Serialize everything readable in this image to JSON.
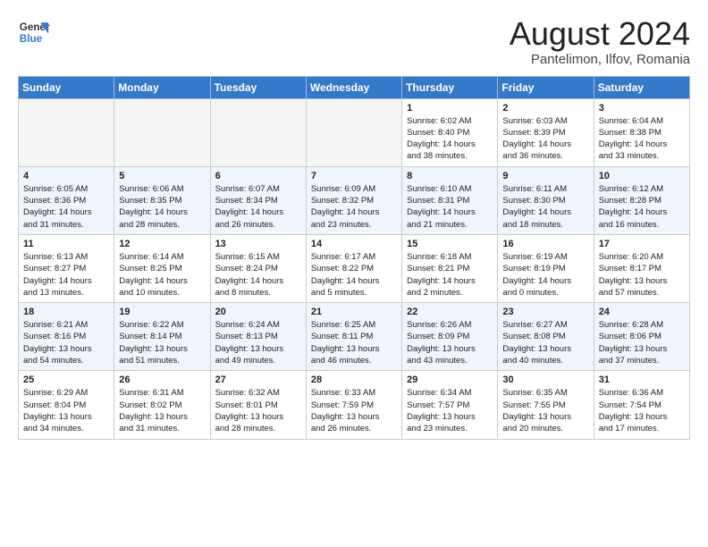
{
  "header": {
    "logo_general": "General",
    "logo_blue": "Blue",
    "month_year": "August 2024",
    "location": "Pantelimon, Ilfov, Romania"
  },
  "weekdays": [
    "Sunday",
    "Monday",
    "Tuesday",
    "Wednesday",
    "Thursday",
    "Friday",
    "Saturday"
  ],
  "weeks": [
    [
      {
        "day": "",
        "info": ""
      },
      {
        "day": "",
        "info": ""
      },
      {
        "day": "",
        "info": ""
      },
      {
        "day": "",
        "info": ""
      },
      {
        "day": "1",
        "info": "Sunrise: 6:02 AM\nSunset: 8:40 PM\nDaylight: 14 hours\nand 38 minutes."
      },
      {
        "day": "2",
        "info": "Sunrise: 6:03 AM\nSunset: 8:39 PM\nDaylight: 14 hours\nand 36 minutes."
      },
      {
        "day": "3",
        "info": "Sunrise: 6:04 AM\nSunset: 8:38 PM\nDaylight: 14 hours\nand 33 minutes."
      }
    ],
    [
      {
        "day": "4",
        "info": "Sunrise: 6:05 AM\nSunset: 8:36 PM\nDaylight: 14 hours\nand 31 minutes."
      },
      {
        "day": "5",
        "info": "Sunrise: 6:06 AM\nSunset: 8:35 PM\nDaylight: 14 hours\nand 28 minutes."
      },
      {
        "day": "6",
        "info": "Sunrise: 6:07 AM\nSunset: 8:34 PM\nDaylight: 14 hours\nand 26 minutes."
      },
      {
        "day": "7",
        "info": "Sunrise: 6:09 AM\nSunset: 8:32 PM\nDaylight: 14 hours\nand 23 minutes."
      },
      {
        "day": "8",
        "info": "Sunrise: 6:10 AM\nSunset: 8:31 PM\nDaylight: 14 hours\nand 21 minutes."
      },
      {
        "day": "9",
        "info": "Sunrise: 6:11 AM\nSunset: 8:30 PM\nDaylight: 14 hours\nand 18 minutes."
      },
      {
        "day": "10",
        "info": "Sunrise: 6:12 AM\nSunset: 8:28 PM\nDaylight: 14 hours\nand 16 minutes."
      }
    ],
    [
      {
        "day": "11",
        "info": "Sunrise: 6:13 AM\nSunset: 8:27 PM\nDaylight: 14 hours\nand 13 minutes."
      },
      {
        "day": "12",
        "info": "Sunrise: 6:14 AM\nSunset: 8:25 PM\nDaylight: 14 hours\nand 10 minutes."
      },
      {
        "day": "13",
        "info": "Sunrise: 6:15 AM\nSunset: 8:24 PM\nDaylight: 14 hours\nand 8 minutes."
      },
      {
        "day": "14",
        "info": "Sunrise: 6:17 AM\nSunset: 8:22 PM\nDaylight: 14 hours\nand 5 minutes."
      },
      {
        "day": "15",
        "info": "Sunrise: 6:18 AM\nSunset: 8:21 PM\nDaylight: 14 hours\nand 2 minutes."
      },
      {
        "day": "16",
        "info": "Sunrise: 6:19 AM\nSunset: 8:19 PM\nDaylight: 14 hours\nand 0 minutes."
      },
      {
        "day": "17",
        "info": "Sunrise: 6:20 AM\nSunset: 8:17 PM\nDaylight: 13 hours\nand 57 minutes."
      }
    ],
    [
      {
        "day": "18",
        "info": "Sunrise: 6:21 AM\nSunset: 8:16 PM\nDaylight: 13 hours\nand 54 minutes."
      },
      {
        "day": "19",
        "info": "Sunrise: 6:22 AM\nSunset: 8:14 PM\nDaylight: 13 hours\nand 51 minutes."
      },
      {
        "day": "20",
        "info": "Sunrise: 6:24 AM\nSunset: 8:13 PM\nDaylight: 13 hours\nand 49 minutes."
      },
      {
        "day": "21",
        "info": "Sunrise: 6:25 AM\nSunset: 8:11 PM\nDaylight: 13 hours\nand 46 minutes."
      },
      {
        "day": "22",
        "info": "Sunrise: 6:26 AM\nSunset: 8:09 PM\nDaylight: 13 hours\nand 43 minutes."
      },
      {
        "day": "23",
        "info": "Sunrise: 6:27 AM\nSunset: 8:08 PM\nDaylight: 13 hours\nand 40 minutes."
      },
      {
        "day": "24",
        "info": "Sunrise: 6:28 AM\nSunset: 8:06 PM\nDaylight: 13 hours\nand 37 minutes."
      }
    ],
    [
      {
        "day": "25",
        "info": "Sunrise: 6:29 AM\nSunset: 8:04 PM\nDaylight: 13 hours\nand 34 minutes."
      },
      {
        "day": "26",
        "info": "Sunrise: 6:31 AM\nSunset: 8:02 PM\nDaylight: 13 hours\nand 31 minutes."
      },
      {
        "day": "27",
        "info": "Sunrise: 6:32 AM\nSunset: 8:01 PM\nDaylight: 13 hours\nand 28 minutes."
      },
      {
        "day": "28",
        "info": "Sunrise: 6:33 AM\nSunset: 7:59 PM\nDaylight: 13 hours\nand 26 minutes."
      },
      {
        "day": "29",
        "info": "Sunrise: 6:34 AM\nSunset: 7:57 PM\nDaylight: 13 hours\nand 23 minutes."
      },
      {
        "day": "30",
        "info": "Sunrise: 6:35 AM\nSunset: 7:55 PM\nDaylight: 13 hours\nand 20 minutes."
      },
      {
        "day": "31",
        "info": "Sunrise: 6:36 AM\nSunset: 7:54 PM\nDaylight: 13 hours\nand 17 minutes."
      }
    ]
  ]
}
